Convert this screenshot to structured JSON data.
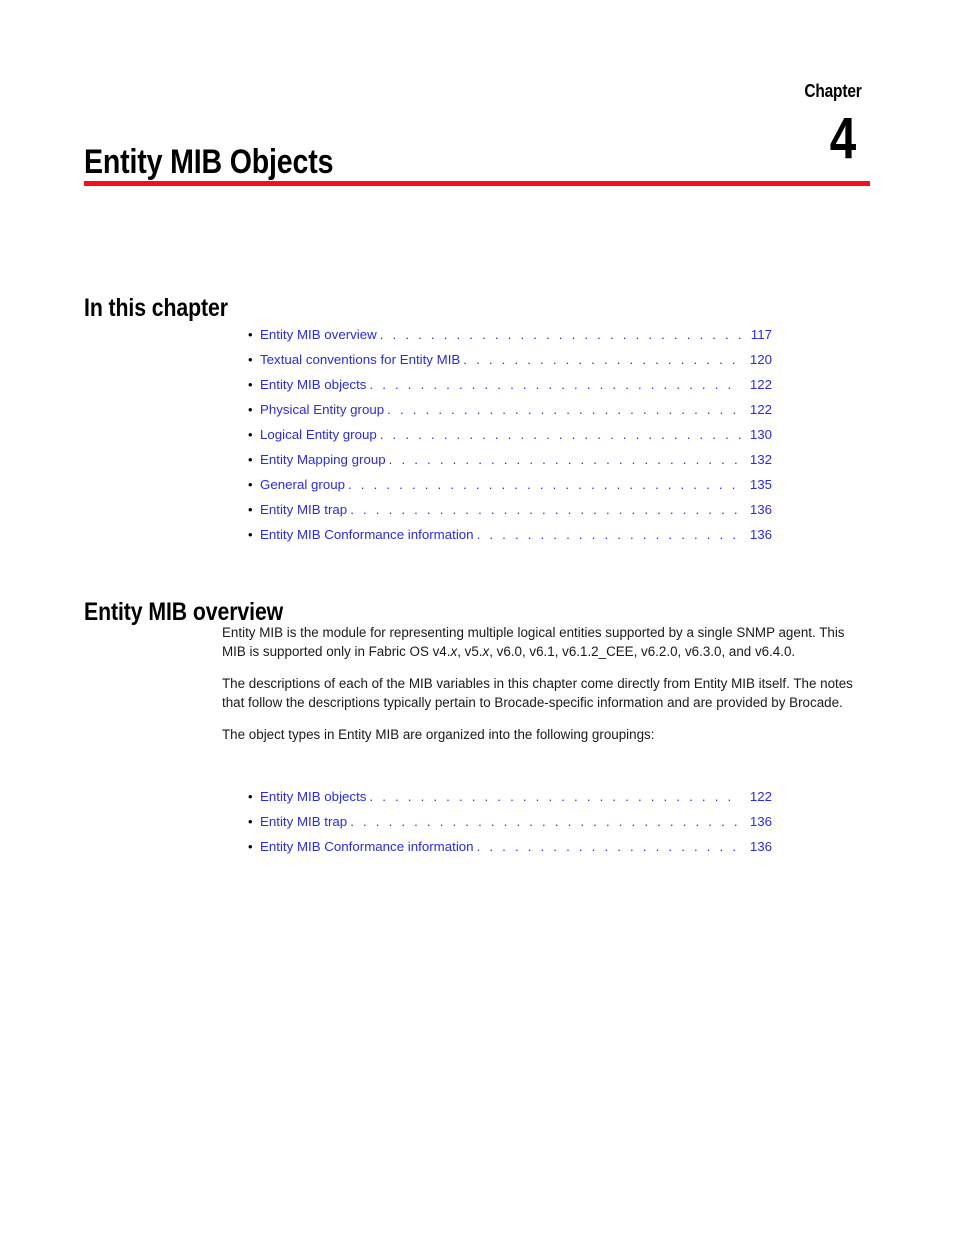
{
  "chapter": {
    "label": "Chapter",
    "number": "4",
    "title": "Entity MIB Objects",
    "rule_color": "#f50f1e"
  },
  "link_color": "#2b2bdb",
  "sections": {
    "in_this_chapter": "In this chapter",
    "entity_mib_overview": "Entity MIB overview"
  },
  "toc_main": [
    {
      "label": "Entity MIB overview",
      "page": "117"
    },
    {
      "label": "Textual conventions for Entity MIB",
      "page": "120"
    },
    {
      "label": "Entity MIB objects",
      "page": "122"
    },
    {
      "label": "Physical Entity group",
      "page": "122"
    },
    {
      "label": "Logical Entity group",
      "page": "130"
    },
    {
      "label": "Entity Mapping group",
      "page": "132"
    },
    {
      "label": "General group",
      "page": "135"
    },
    {
      "label": "Entity MIB trap",
      "page": "136"
    },
    {
      "label": "Entity MIB Conformance information",
      "page": "136"
    }
  ],
  "toc_groupings": [
    {
      "label": "Entity MIB objects",
      "page": "122"
    },
    {
      "label": "Entity MIB trap",
      "page": "136"
    },
    {
      "label": "Entity MIB Conformance information",
      "page": "136"
    }
  ],
  "paragraphs": {
    "p1_a": "Entity MIB is the module for representing multiple logical entities supported by a single SNMP agent. This MIB is supported only in Fabric OS v4.",
    "p1_italic1": "x",
    "p1_b": ", v5.",
    "p1_italic2": "x",
    "p1_c": ", v6.0, v6.1, v6.1.2_CEE, v6.2.0, v6.3.0, and v6.4.0.",
    "p2": "The descriptions of each of the MIB variables in this chapter come directly from Entity MIB itself. The notes that follow the descriptions typically pertain to Brocade-specific information and are provided by Brocade.",
    "p3": "The object types in Entity MIB are organized into the following groupings:"
  }
}
